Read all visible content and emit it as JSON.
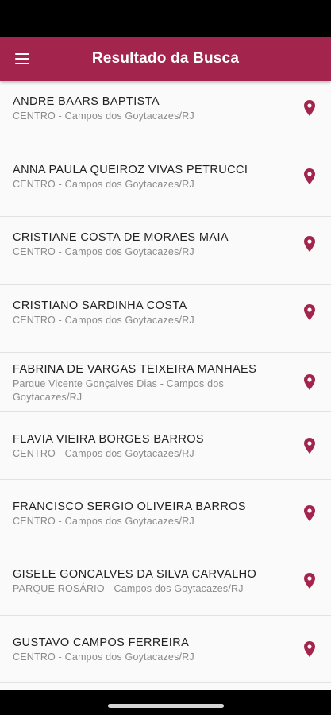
{
  "header": {
    "title": "Resultado da Busca",
    "menu_icon": "hamburger-menu-icon"
  },
  "colors": {
    "primary": "#a3244c",
    "list_background": "#fafafa",
    "name_text": "#222222",
    "address_text": "#8a8a8a"
  },
  "results": [
    {
      "name": "ANDRE BAARS BAPTISTA",
      "address": "CENTRO - Campos dos Goytacazes/RJ",
      "icon": "map-pin-icon"
    },
    {
      "name": "ANNA PAULA QUEIROZ VIVAS PETRUCCI",
      "address": "CENTRO - Campos dos Goytacazes/RJ",
      "icon": "map-pin-icon"
    },
    {
      "name": "CRISTIANE COSTA DE MORAES MAIA",
      "address": "CENTRO - Campos dos Goytacazes/RJ",
      "icon": "map-pin-icon"
    },
    {
      "name": "CRISTIANO SARDINHA COSTA",
      "address": "CENTRO - Campos dos Goytacazes/RJ",
      "icon": "map-pin-icon"
    },
    {
      "name": "FABRINA DE VARGAS TEIXEIRA MANHAES",
      "address": "Parque Vicente Gonçalves Dias - Campos dos Goytacazes/RJ",
      "icon": "map-pin-icon"
    },
    {
      "name": "FLAVIA VIEIRA BORGES BARROS",
      "address": "CENTRO - Campos dos Goytacazes/RJ",
      "icon": "map-pin-icon"
    },
    {
      "name": "FRANCISCO SERGIO OLIVEIRA BARROS",
      "address": "CENTRO - Campos dos Goytacazes/RJ",
      "icon": "map-pin-icon"
    },
    {
      "name": "GISELE GONCALVES DA SILVA CARVALHO",
      "address": "PARQUE ROSÁRIO - Campos dos Goytacazes/RJ",
      "icon": "map-pin-icon"
    },
    {
      "name": "GUSTAVO CAMPOS FERREIRA",
      "address": "CENTRO - Campos dos Goytacazes/RJ",
      "icon": "map-pin-icon"
    }
  ]
}
